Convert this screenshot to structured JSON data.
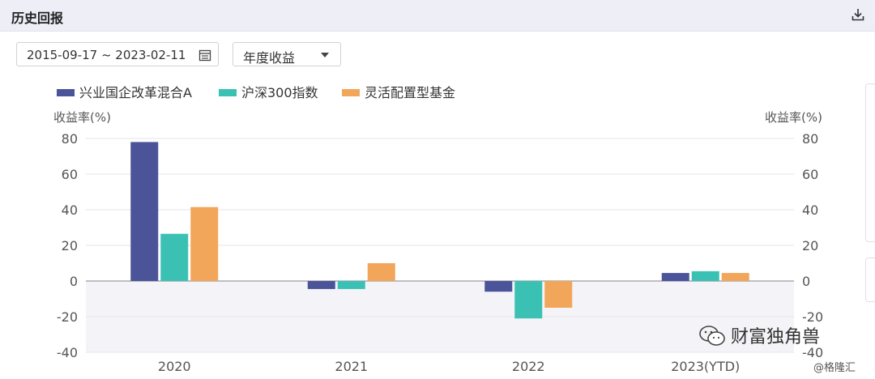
{
  "header": {
    "title": "历史回报",
    "download_icon": "download-icon"
  },
  "controls": {
    "date_range": "2015-09-17 ~ 2023-02-11",
    "calendar_icon": "calendar-icon",
    "period_select": "年度收益",
    "dropdown_icon": "caret-down-icon"
  },
  "chart_data": {
    "type": "bar",
    "categories": [
      "2020",
      "2021",
      "2022",
      "2023(YTD)"
    ],
    "series": [
      {
        "name": "兴业国企改革混合A",
        "color": "#4b5499",
        "values": [
          78,
          -4.5,
          -6,
          4.5
        ]
      },
      {
        "name": "沪深300指数",
        "color": "#3bc1b4",
        "values": [
          26.5,
          -4.5,
          -21,
          5.5
        ]
      },
      {
        "name": "灵活配置型基金",
        "color": "#f2a65a",
        "values": [
          41.5,
          10,
          -15,
          4.5
        ]
      }
    ],
    "ylabel_left": "收益率(%)",
    "ylabel_right": "收益率(%)",
    "ylim": [
      -40,
      80
    ],
    "yticks": [
      80,
      60,
      40,
      20,
      0,
      -20,
      -40
    ],
    "grid": true,
    "legend_position": "top-left"
  },
  "watermark": {
    "text": "财富独角兽",
    "small": "@格隆汇"
  }
}
